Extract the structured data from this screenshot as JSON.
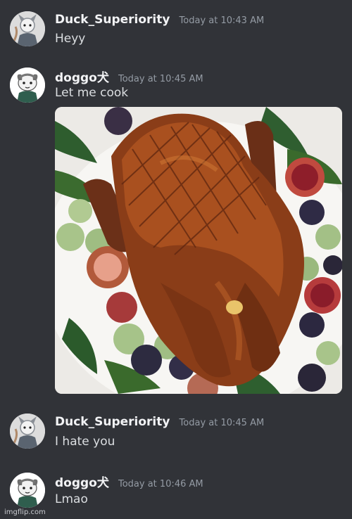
{
  "messages": [
    {
      "username": "Duck_Superiority",
      "timestamp": "Today at 10:43 AM",
      "text": "Heyy",
      "avatar": "duck-avatar"
    },
    {
      "username": "doggo犬",
      "timestamp": "Today at 10:45 AM",
      "text": "Let me cook",
      "avatar": "doggo-avatar",
      "attachment": "roast-duck-image"
    },
    {
      "username": "Duck_Superiority",
      "timestamp": "Today at 10:45 AM",
      "text": "I hate you",
      "avatar": "duck-avatar"
    },
    {
      "username": "doggo犬",
      "timestamp": "Today at 10:46 AM",
      "text": "Lmao",
      "avatar": "doggo-avatar"
    }
  ],
  "watermark": "imgflip.com",
  "colors": {
    "background": "#313338",
    "username": "#f2f3f5",
    "text": "#dbdee1",
    "timestamp": "#949ba4"
  }
}
